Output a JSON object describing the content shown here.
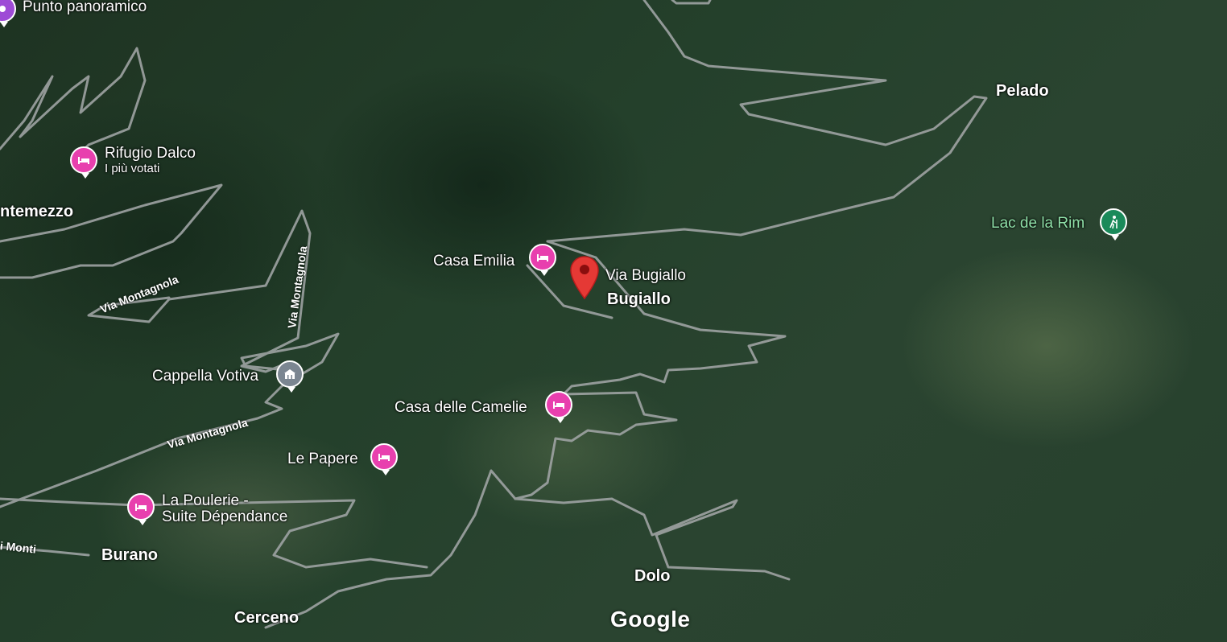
{
  "places": {
    "punto_panoramico": "Punto panoramico",
    "rifugio_dalco": "Rifugio Dalco",
    "rifugio_dalco_badge": "I più votati",
    "montemezzo": "ntemezzo",
    "pelado": "Pelado",
    "lac_de_la_rim": "Lac de la Rim",
    "casa_emilia": "Casa Emilia",
    "via_bugiallo": "Via Bugiallo",
    "bugiallo": "Bugiallo",
    "cappella_votiva": "Cappella Votiva",
    "casa_delle_camelie": "Casa delle Camelie",
    "le_papere": "Le Papere",
    "la_poulerie_line1": "La Poulerie -",
    "la_poulerie_line2": "Suite Dépendance",
    "burano": "Burano",
    "cerceno": "Cerceno",
    "dolo": "Dolo"
  },
  "roads": {
    "via_montagnola_1": "Via Montagnola",
    "via_montagnola_2": "Via Montagnola",
    "via_montagnola_3": "Via Montagnola",
    "monti": "i Monti"
  },
  "attribution": "Google",
  "icons": {
    "lodging": "bed-icon",
    "chapel": "chapel-icon",
    "hiking": "hiking-icon",
    "viewpoint": "viewpoint-icon",
    "location": "location-pin-icon"
  },
  "colors": {
    "lodging": "#e83fae",
    "chapel": "#7b8691",
    "hiking": "#1a8a5a",
    "marker": "#e53935",
    "road": "#9aa0a0"
  }
}
